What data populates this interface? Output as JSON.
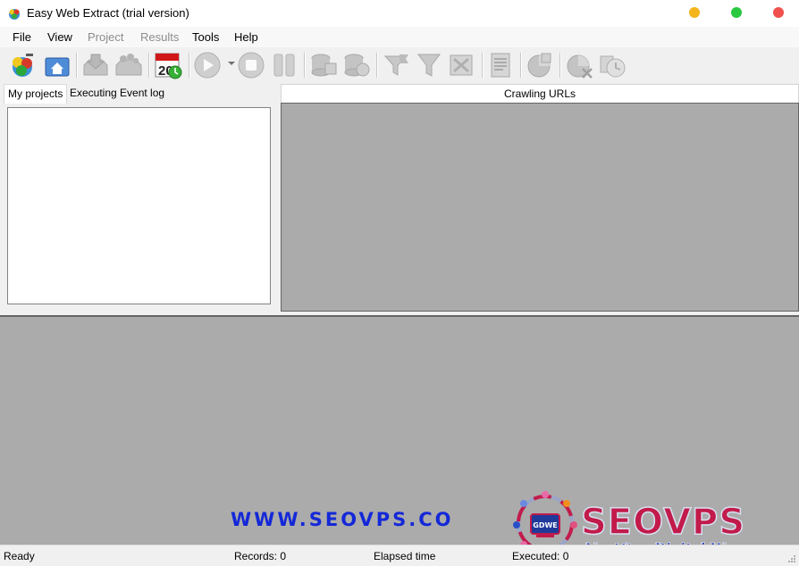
{
  "window": {
    "title": "Easy Web Extract (trial version)",
    "controls": {
      "minimize_color": "#f4b41c",
      "maximize_color": "#28c840",
      "close_color": "#f0514d"
    }
  },
  "menu": [
    {
      "label": "File",
      "enabled": true
    },
    {
      "label": "View",
      "enabled": true
    },
    {
      "label": "Project",
      "enabled": false
    },
    {
      "label": "Results",
      "enabled": false
    },
    {
      "label": "Tools",
      "enabled": true
    },
    {
      "label": "Help",
      "enabled": true
    }
  ],
  "toolbar": {
    "buttons": [
      {
        "icon": "new-project-icon",
        "enabled": true
      },
      {
        "icon": "home-icon",
        "enabled": true
      },
      {
        "icon": "open-project-icon",
        "enabled": false
      },
      {
        "icon": "save-project-icon",
        "enabled": false
      },
      {
        "icon": "schedule-calendar-icon",
        "enabled": true,
        "calendar_day": "20"
      },
      {
        "icon": "play-icon",
        "enabled": false
      },
      {
        "icon": "stop-icon",
        "enabled": false
      },
      {
        "icon": "pause-icon",
        "enabled": false
      },
      {
        "icon": "database-icon",
        "enabled": false
      },
      {
        "icon": "database-export-icon",
        "enabled": false
      },
      {
        "icon": "flag-filter-icon",
        "enabled": false
      },
      {
        "icon": "funnel-filter-icon",
        "enabled": false
      },
      {
        "icon": "clear-filter-icon",
        "enabled": false
      },
      {
        "icon": "report-icon",
        "enabled": false
      },
      {
        "icon": "chart-export-icon",
        "enabled": false
      },
      {
        "icon": "chart-delete-icon",
        "enabled": false
      },
      {
        "icon": "clock-icon",
        "enabled": false
      }
    ]
  },
  "left_panel": {
    "tabs": [
      {
        "label": "My projects",
        "active": true
      },
      {
        "label": "Executing Event log",
        "active": false
      }
    ]
  },
  "right_panel": {
    "column_header": "Crawling URLs"
  },
  "status": {
    "state": "Ready",
    "records": "Records: 0",
    "elapsed": "Elapsed time",
    "executed": "Executed: 0"
  },
  "watermark": {
    "url": "WWW.SEOVPS.CO",
    "brand": "SEOVPS",
    "tagline": "NextGen Digital Weapons",
    "logo_text": "GDWE"
  }
}
